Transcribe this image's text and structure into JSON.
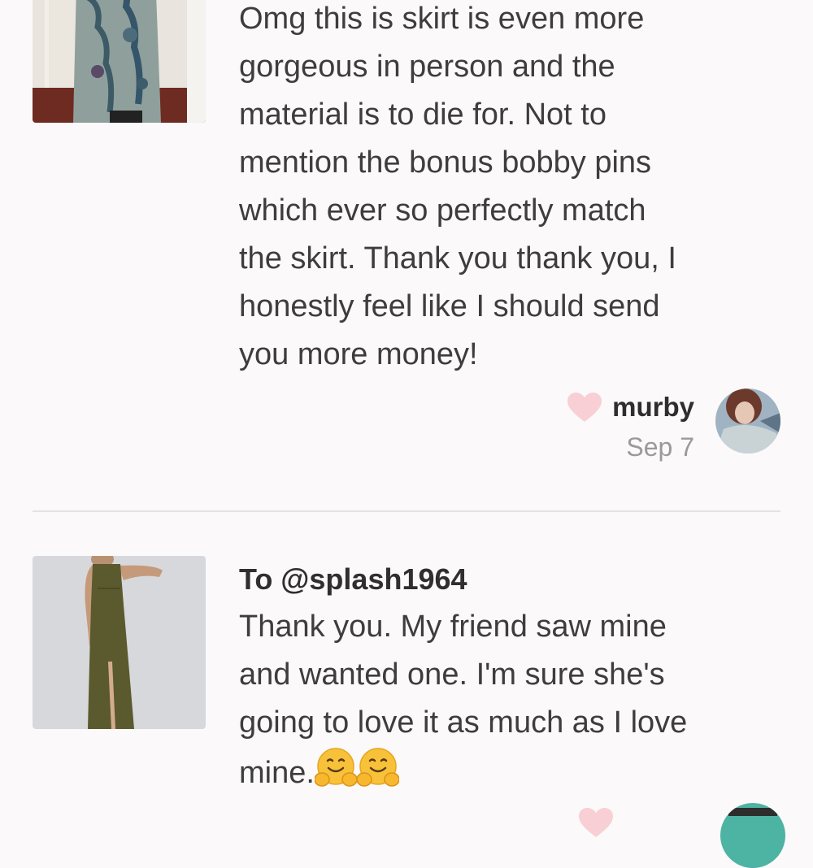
{
  "reviews": [
    {
      "text": "Omg this is skirt is even more\ngorgeous in person and the\nmaterial is to die for. Not to\nmention the bonus bobby pins\nwhich ever so perfectly match\nthe skirt. Thank you thank you, I\nhonestly feel like I should send\nyou more money!",
      "username": "murby",
      "date": "Sep 7",
      "thumbnail": "floral-skirt-photo",
      "heart_icon": "heart-icon",
      "heart_color": "#f9cfd6"
    },
    {
      "to_line": "To @splash1964",
      "text": "Thank you. My friend saw mine\nand wanted one. I'm sure she's\ngoing to love it as much as I love\nmine.",
      "emojis": [
        "hugging-face-emoji",
        "hugging-face-emoji"
      ],
      "thumbnail": "olive-maxi-dress-photo"
    }
  ],
  "colors": {
    "background": "#fbf9fa",
    "divider": "#e4e2e3",
    "text": "#3d3d3d",
    "date": "#9a9a9a",
    "heart": "#f9cfd6"
  }
}
